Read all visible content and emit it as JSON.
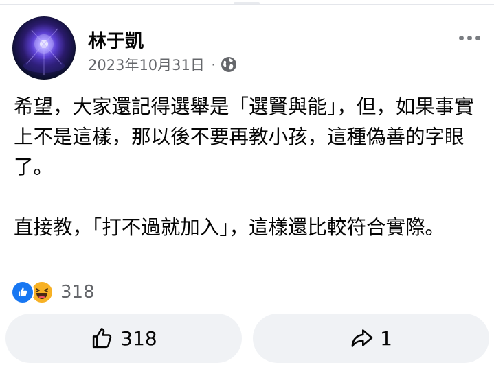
{
  "post": {
    "author": "林于凱",
    "date": "2023年10月31日",
    "separator": "·",
    "privacy_icon": "globe-icon",
    "more_icon": "more-dots-icon",
    "paragraphs": [
      "希望，大家還記得選舉是「選賢與能」，但，如果事實上不是這樣，那以後不要再教小孩，這種偽善的字眼了。",
      "直接教，「打不過就加入」，這樣還比較符合實際。"
    ]
  },
  "reactions": {
    "icons": [
      "like-icon",
      "haha-icon"
    ],
    "count": "318"
  },
  "actions": {
    "like": {
      "icon": "thumbs-up-icon",
      "count": "318"
    },
    "share": {
      "icon": "share-arrow-icon",
      "count": "1"
    }
  },
  "colors": {
    "like_blue": "#1877f2",
    "haha_yellow": "#f7b125",
    "secondary_text": "#65676b",
    "button_bg": "#f0f2f5"
  }
}
